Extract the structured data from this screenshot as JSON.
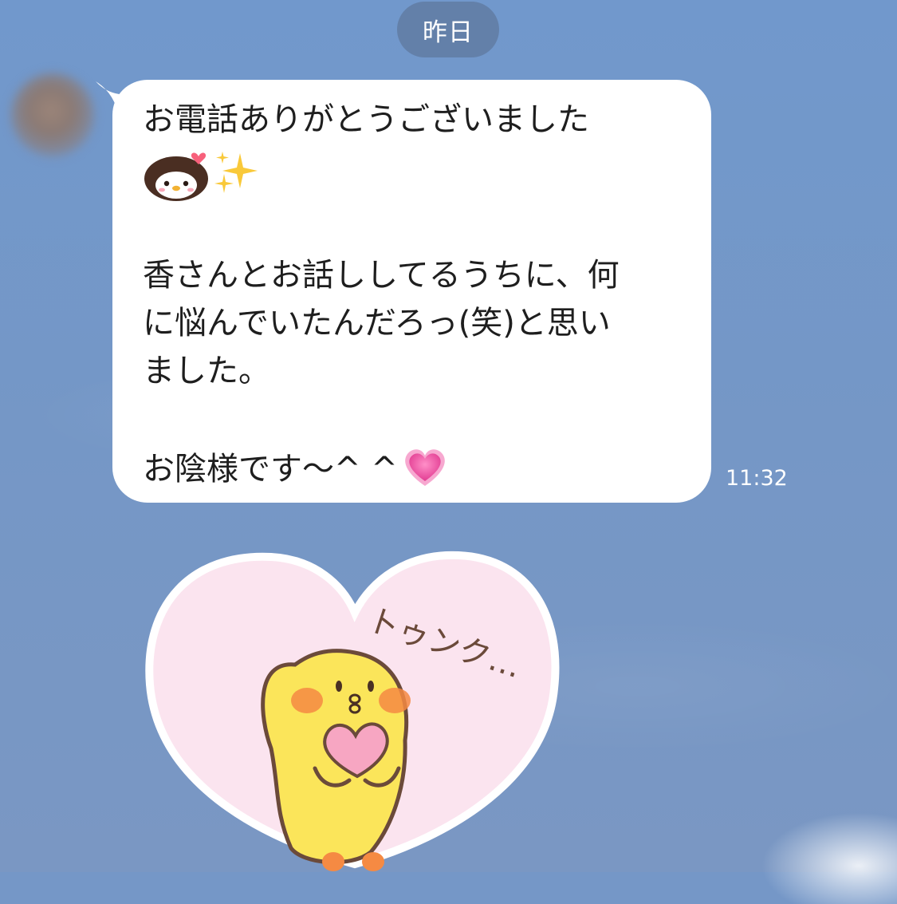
{
  "chat": {
    "date_label": "昨日",
    "message": {
      "line1": "お電話ありがとうございました",
      "emoji_penguin": "penguin-sticker-emoji",
      "emoji_sparkles": "sparkles-emoji",
      "line3": "香さんとお話ししてるうちに、何",
      "line4": "に悩んでいたんだろっ(笑)と思い",
      "line5": "ました。",
      "line7": "お陰様です〜^ ^",
      "emoji_heart": "growing-heart-emoji",
      "time": "11:32"
    },
    "sticker": {
      "text": "トゥンク…",
      "icon": "chick-holding-heart-sticker"
    }
  },
  "colors": {
    "background": "#7597c7",
    "bubble": "#ffffff",
    "date_pill": "#627da5",
    "heart_pink": "#fbe4ef",
    "chick_yellow": "#fbe55a"
  }
}
